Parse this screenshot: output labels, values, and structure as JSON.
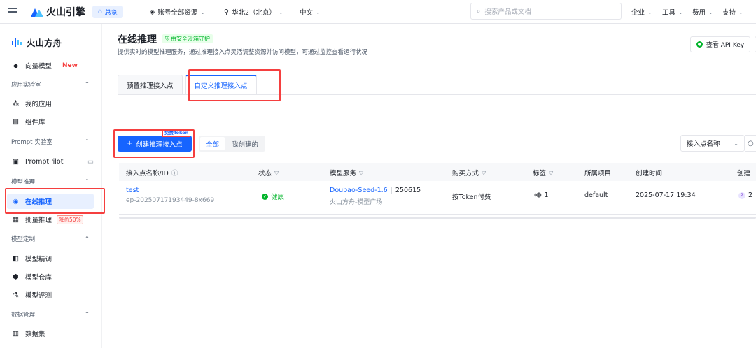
{
  "topbar": {
    "brand": "火山引擎",
    "home": "总览",
    "account_scope": "账号全部资源",
    "region": "华北2（北京）",
    "language": "中文",
    "search_placeholder": "搜索产品或文档",
    "menu": [
      "企业",
      "工具",
      "费用",
      "支持"
    ]
  },
  "sidebar": {
    "brand": "火山方舟",
    "vector_model": "向量模型",
    "vector_badge": "New",
    "groups": {
      "app_lab": "应用实验室",
      "prompt_lab": "Prompt 实验室",
      "inference": "模型推理",
      "customize": "模型定制",
      "data": "数据管理"
    },
    "items": {
      "my_apps": "我的应用",
      "components": "组件库",
      "promptpilot": "PromptPilot",
      "online_inference": "在线推理",
      "batch_inference": "批量推理",
      "batch_badge": "降价50%",
      "fine_tune": "模型精调",
      "model_repo": "模型仓库",
      "model_eval": "模型评测",
      "dataset": "数据集"
    }
  },
  "main": {
    "title": "在线推理",
    "sandbox_badge": "由安全沙箱守护",
    "description": "提供实时的模型推理服务，通过推理接入点灵活调整资源并访问模型，可通过监控查看运行状况",
    "api_key_button": "查看 API Key",
    "tabs": [
      "预置推理接入点",
      "自定义推理接入点"
    ],
    "create_button": "创建推理接入点",
    "free_tag": "免费Token",
    "segment": [
      "全部",
      "我创建的"
    ],
    "filter_select": "接入点名称"
  },
  "table": {
    "headers": [
      "接入点名称/ID",
      "状态",
      "模型服务",
      "购买方式",
      "标签",
      "所属项目",
      "创建时间",
      "创建"
    ],
    "rows": [
      {
        "name": "test",
        "id": "ep-20250717193449-8x669",
        "status": "健康",
        "model": "Doubao-Seed-1.6",
        "model_version": "250615",
        "model_source": "火山方舟-模型广场",
        "purchase": "按Token付费",
        "tags": "1",
        "project": "default",
        "created": "2025-07-17 19:34",
        "creator": "2"
      }
    ]
  },
  "colors": {
    "accent": "#1664ff",
    "highlight": "#f53f3f",
    "success": "#00b42a"
  }
}
